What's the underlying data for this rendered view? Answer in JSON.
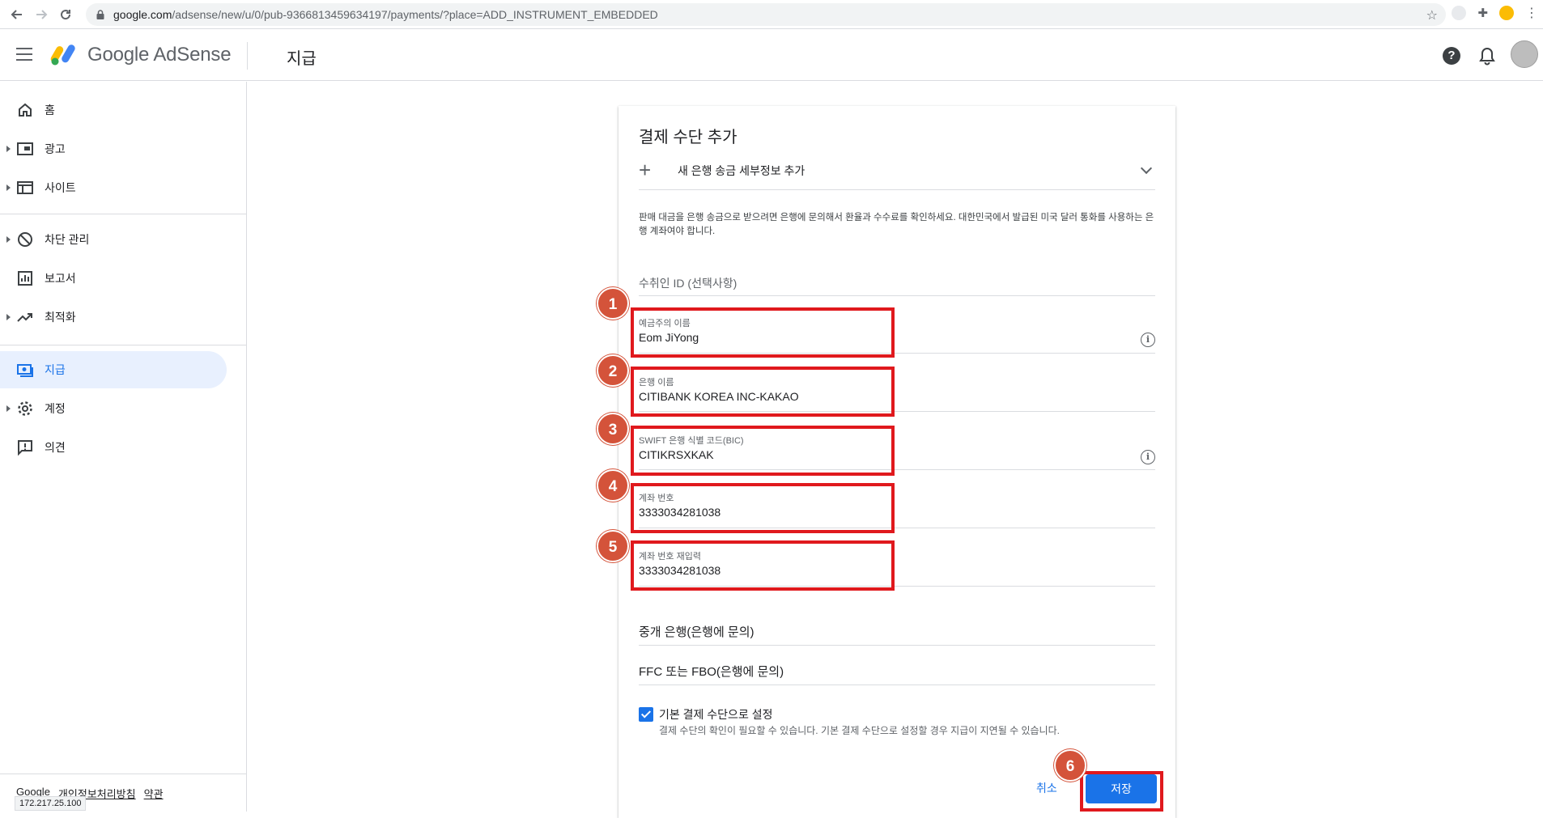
{
  "browser": {
    "url_host": "google.com",
    "url_path": "/adsense/new/u/0/pub-9366813459634197/payments/?place=ADD_INSTRUMENT_EMBEDDED"
  },
  "header": {
    "logo_text": "Google AdSense",
    "page_title": "지급",
    "help_symbol": "?"
  },
  "sidebar": {
    "items": [
      {
        "label": "홈"
      },
      {
        "label": "광고"
      },
      {
        "label": "사이트"
      },
      {
        "label": "차단 관리"
      },
      {
        "label": "보고서"
      },
      {
        "label": "최적화"
      },
      {
        "label": "지급"
      },
      {
        "label": "계정"
      },
      {
        "label": "의견"
      }
    ],
    "footer": {
      "google": "Google",
      "privacy": "개인정보처리방침",
      "terms": "약관"
    },
    "status_ip": "172.217.25.100"
  },
  "card": {
    "title": "결제 수단 추가",
    "add_bank_label": "새 은행 송금 세부정보 추가",
    "notice": "판매 대금을 은행 송금으로 받으려면 은행에 문의해서 환율과 수수료를 확인하세요. 대한민국에서 발급된 미국 달러 통화를 사용하는 은행 계좌여야 합니다.",
    "payee_id_placeholder": "수취인 ID (선택사항)",
    "fields": {
      "holder": {
        "label": "예금주의 이름",
        "value": "Eom JiYong"
      },
      "bank": {
        "label": "은행 이름",
        "value": "CITIBANK KOREA INC-KAKAO"
      },
      "swift": {
        "label": "SWIFT 은행 식별 코드(BIC)",
        "value": "CITIKRSXKAK"
      },
      "account": {
        "label": "계좌 번호",
        "value": "3333034281038"
      },
      "account_confirm": {
        "label": "계좌 번호 재입력",
        "value": "3333034281038"
      }
    },
    "intermediary_placeholder": "중개 은행(은행에 문의)",
    "ffc_placeholder": "FFC 또는 FBO(은행에 문의)",
    "default_checkbox": {
      "label": "기본 결제 수단으로 설정",
      "sub": "결제 수단의 확인이 필요할 수 있습니다. 기본 결제 수단으로 설정할 경우 지급이 지연될 수 있습니다.",
      "checked": true
    },
    "cancel_label": "취소",
    "save_label": "저장"
  },
  "annotations": {
    "badges": [
      "1",
      "2",
      "3",
      "4",
      "5",
      "6"
    ],
    "highlight_color": "#e0191d",
    "badge_color": "#d4533a"
  },
  "colors": {
    "accent": "#1a73e8"
  }
}
